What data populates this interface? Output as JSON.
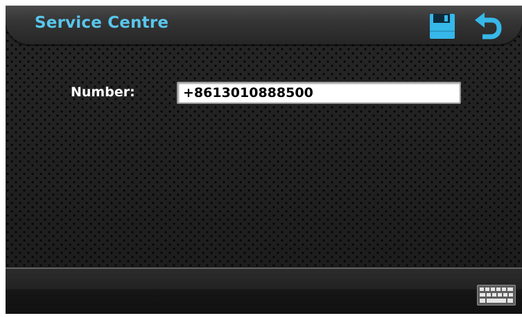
{
  "header": {
    "title": "Service Centre",
    "save_icon": "floppy-disk-icon",
    "back_icon": "back-arrow-icon"
  },
  "form": {
    "number_label": "Number:",
    "number_value": "+8613010888500"
  },
  "footer": {
    "keyboard_icon": "keyboard-icon"
  },
  "colors": {
    "title_accent": "#59c6ec",
    "icon_accent": "#36b8ea",
    "background": "#1f1f1f"
  }
}
